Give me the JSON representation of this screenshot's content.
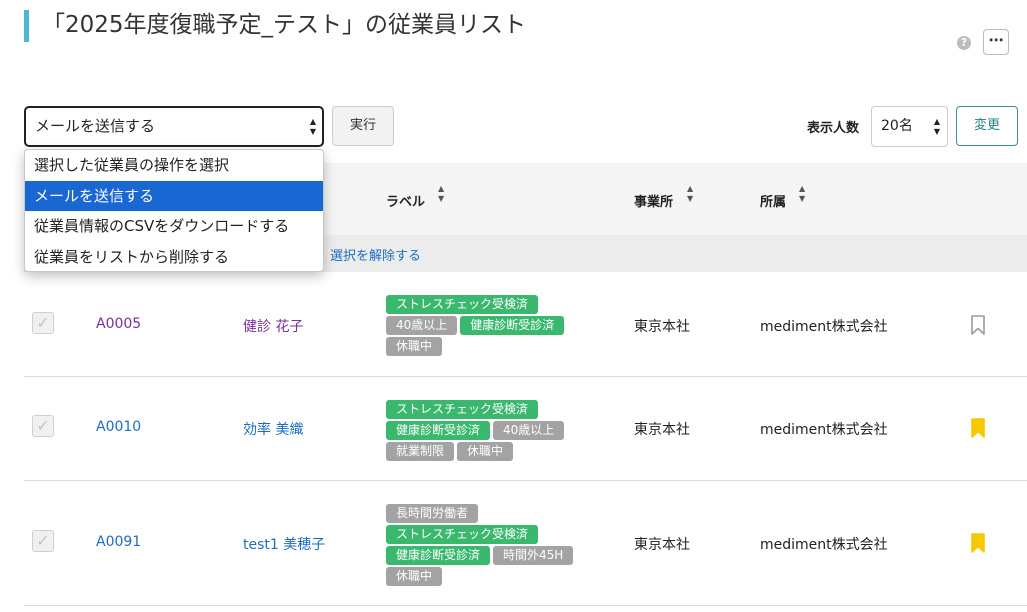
{
  "header": {
    "title": "「2025年度復職予定_テスト」の従業員リスト",
    "help_icon": "?",
    "more_icon": "⋯"
  },
  "toolbar": {
    "action_select_value": "メールを送信する",
    "execute_label": "実行",
    "count_label": "表示人数",
    "count_value": "20名",
    "change_label": "変更"
  },
  "action_menu": {
    "options": [
      "選択した従業員の操作を選択",
      "メールを送信する",
      "従業員情報のCSVをダウンロードする",
      "従業員をリストから削除する"
    ],
    "highlighted_index": 1
  },
  "table": {
    "columns": {
      "label": "ラベル",
      "office": "事業所",
      "dept": "所属"
    },
    "clear_selection": "選択を解除する",
    "rows": [
      {
        "id": "A0005",
        "name": "健診 花子",
        "office": "東京本社",
        "dept": "mediment株式会社",
        "bookmarked": false,
        "label_lines": [
          [
            {
              "text": "ストレスチェック受検済",
              "color": "green"
            }
          ],
          [
            {
              "text": "40歳以上",
              "color": "gray"
            },
            {
              "text": "健康診断受診済",
              "color": "green"
            }
          ],
          [
            {
              "text": "休職中",
              "color": "gray"
            }
          ]
        ]
      },
      {
        "id": "A0010",
        "name": "効率 美織",
        "office": "東京本社",
        "dept": "mediment株式会社",
        "bookmarked": true,
        "label_lines": [
          [
            {
              "text": "ストレスチェック受検済",
              "color": "green"
            }
          ],
          [
            {
              "text": "健康診断受診済",
              "color": "green"
            },
            {
              "text": "40歳以上",
              "color": "gray"
            }
          ],
          [
            {
              "text": "就業制限",
              "color": "gray"
            },
            {
              "text": "休職中",
              "color": "gray"
            }
          ]
        ]
      },
      {
        "id": "A0091",
        "name": "test1 美穂子",
        "office": "東京本社",
        "dept": "mediment株式会社",
        "bookmarked": true,
        "label_lines": [
          [
            {
              "text": "長時間労働者",
              "color": "gray"
            }
          ],
          [
            {
              "text": "ストレスチェック受検済",
              "color": "green"
            }
          ],
          [
            {
              "text": "健康診断受診済",
              "color": "green"
            },
            {
              "text": "時間外45H",
              "color": "gray"
            }
          ],
          [
            {
              "text": "休職中",
              "color": "gray"
            }
          ]
        ]
      }
    ]
  },
  "colors": {
    "accent": "#4bb8d0",
    "label_green": "#3ab86e",
    "label_gray": "#a3a3a3",
    "bookmark_on": "#f5c800",
    "bookmark_off": "#9a9a9a",
    "link": "#1a6ec2"
  },
  "icons": [
    "question-icon",
    "more-icon",
    "sort-icon",
    "checkbox-icon",
    "bookmark-icon"
  ]
}
